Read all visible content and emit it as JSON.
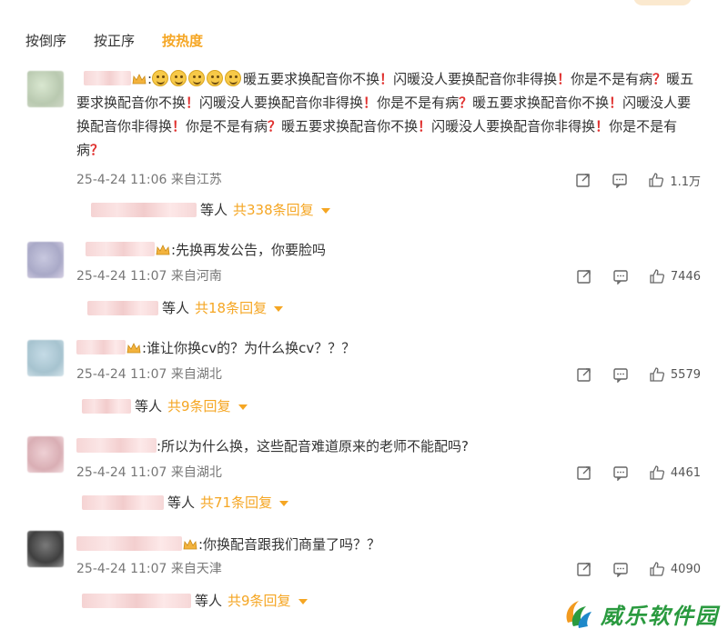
{
  "sort_tabs": [
    {
      "label": "按倒序",
      "active": false
    },
    {
      "label": "按正序",
      "active": false
    },
    {
      "label": "按热度",
      "active": true
    }
  ],
  "comments": [
    {
      "text_parts": [
        {
          "t": "暖五要求换配音你不换",
          "k": "txt"
        },
        {
          "t": "！",
          "k": "ex"
        },
        {
          "t": "闪暖没人要换配音你非得换",
          "k": "txt"
        },
        {
          "t": "！",
          "k": "ex"
        },
        {
          "t": "你是不是有病",
          "k": "txt"
        },
        {
          "t": "？",
          "k": "q"
        },
        {
          "t": "暖五要求换配音你不换",
          "k": "txt"
        },
        {
          "t": "！",
          "k": "ex"
        },
        {
          "t": "闪暖没人要换配音你非得换",
          "k": "txt"
        },
        {
          "t": "！",
          "k": "ex"
        },
        {
          "t": "你是不是有病",
          "k": "txt"
        },
        {
          "t": "？",
          "k": "q"
        },
        {
          "t": "暖五要求换配音你不换",
          "k": "txt"
        },
        {
          "t": "！",
          "k": "ex"
        },
        {
          "t": "闪暖没人要换配音你非得换",
          "k": "txt"
        },
        {
          "t": "！",
          "k": "ex"
        },
        {
          "t": "你是不是有病",
          "k": "txt"
        },
        {
          "t": "？",
          "k": "q"
        },
        {
          "t": "暖五要求换配音你不换",
          "k": "txt"
        },
        {
          "t": "！",
          "k": "ex"
        },
        {
          "t": "闪暖没人要换配音你非得换",
          "k": "txt"
        },
        {
          "t": "！",
          "k": "ex"
        },
        {
          "t": "你是不是有病",
          "k": "txt"
        },
        {
          "t": "？",
          "k": "q"
        }
      ],
      "prefix": ":",
      "emoji_count": 5,
      "timestamp": "25-4-24 11:06",
      "location": "来自江苏",
      "likes": "1.1万",
      "reply_suffix": "等人",
      "reply_count": "共338条回复"
    },
    {
      "text": ":先换再发公告，你要脸吗",
      "timestamp": "25-4-24 11:07",
      "location": "来自河南",
      "likes": "7446",
      "reply_suffix": "等人",
      "reply_count": "共18条回复"
    },
    {
      "text": ":谁让你换cv的？为什么换cv？？？",
      "timestamp": "25-4-24 11:07",
      "location": "来自湖北",
      "likes": "5579",
      "reply_suffix": "等人",
      "reply_count": "共9条回复"
    },
    {
      "text": ":所以为什么换，这些配音难道原来的老师不能配吗?",
      "timestamp": "25-4-24 11:07",
      "location": "来自湖北",
      "likes": "4461",
      "reply_suffix": "等人",
      "reply_count": "共71条回复"
    },
    {
      "text": ":你换配音跟我们商量了吗？？",
      "timestamp": "25-4-24 11:07",
      "location": "来自天津",
      "likes": "4090",
      "reply_suffix": "等人",
      "reply_count": "共9条回复"
    }
  ],
  "watermark": {
    "text": "威乐软件园"
  },
  "icons": {
    "share": "share-icon",
    "comment": "comment-icon",
    "like": "like-icon",
    "crown": "crown-icon",
    "caret": "caret-down-icon"
  },
  "colors": {
    "accent": "#f5a623",
    "exclaim": "#e0312f",
    "watermark": "#2a9a3f"
  }
}
